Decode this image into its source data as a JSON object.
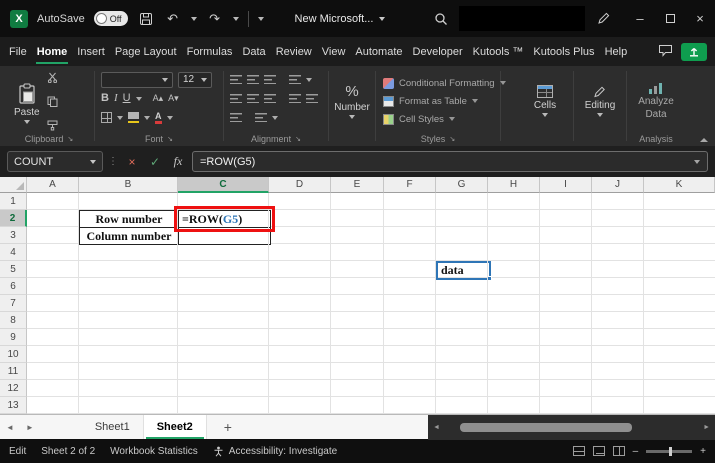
{
  "colors": {
    "accent-green": "#21a366",
    "brand-green": "#107c41",
    "share-green": "#0f9d4f",
    "annotation-red": "#ee1111",
    "ref-blue": "#2e75b6",
    "header-sel-green": "#0f6b3c"
  },
  "icons": {
    "excel_logo": "X",
    "undo": "↶",
    "redo": "↷",
    "minimize": "–",
    "close": "×",
    "name_box_divider": "⋮",
    "cancel": "×",
    "enter": "✓",
    "percent": "%",
    "grow_font": "A▴",
    "shrink_font": "A▾",
    "launcher": "↘",
    "nav_left": "◄",
    "nav_right": "►",
    "zoom_minus": "–",
    "zoom_plus": "+"
  },
  "titlebar": {
    "autosave_label": "AutoSave",
    "autosave_state": "Off",
    "doc_title": "New Microsoft..."
  },
  "menubar": {
    "tabs": [
      {
        "label": "File"
      },
      {
        "label": "Home",
        "active": true
      },
      {
        "label": "Insert"
      },
      {
        "label": "Page Layout"
      },
      {
        "label": "Formulas"
      },
      {
        "label": "Data"
      },
      {
        "label": "Review"
      },
      {
        "label": "View"
      },
      {
        "label": "Automate"
      },
      {
        "label": "Developer"
      },
      {
        "label": "Kutools ™"
      },
      {
        "label": "Kutools Plus"
      },
      {
        "label": "Help"
      }
    ]
  },
  "ribbon": {
    "paste": "Paste",
    "clipboard_group": "Clipboard",
    "font_size": "12",
    "bold": "B",
    "italic": "I",
    "underline": "U",
    "font_group": "Font",
    "alignment_group": "Alignment",
    "number_button": "Number",
    "styles": [
      {
        "label": "Conditional Formatting"
      },
      {
        "label": "Format as Table"
      },
      {
        "label": "Cell Styles"
      }
    ],
    "styles_group": "Styles",
    "cells_button": "Cells",
    "editing_button": "Editing",
    "analyze_line1": "Analyze",
    "analyze_line2": "Data",
    "analysis_group": "Analysis"
  },
  "formula_bar": {
    "name_box": "COUNT",
    "fx_label": "fx",
    "formula": "=ROW(G5)"
  },
  "grid": {
    "columns": [
      "A",
      "B",
      "C",
      "D",
      "E",
      "F",
      "G",
      "H",
      "I",
      "J",
      "K"
    ],
    "rows": [
      "1",
      "2",
      "3",
      "4",
      "5",
      "6",
      "7",
      "8",
      "9",
      "10",
      "11",
      "12",
      "13"
    ],
    "selected_column": "C",
    "selected_row": "2",
    "cells": {
      "b2": "Row number",
      "b3": "Column number",
      "c2_prefix": "=ROW(",
      "c2_ref": "G5",
      "c2_suffix": ")",
      "g5": "data"
    }
  },
  "tabbar": {
    "sheets": [
      {
        "label": "Sheet1"
      },
      {
        "label": "Sheet2",
        "active": true
      }
    ],
    "add_sheet": "+"
  },
  "statusbar": {
    "mode": "Edit",
    "sheet_info": "Sheet 2 of 2",
    "workbook_statistics": "Workbook Statistics",
    "accessibility": "Accessibility: Investigate"
  }
}
